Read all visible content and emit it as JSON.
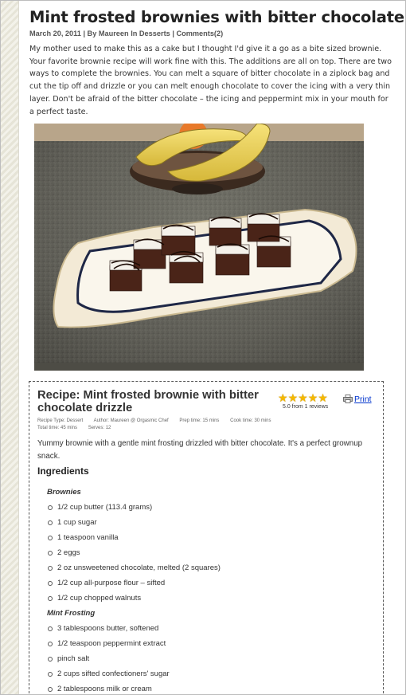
{
  "post": {
    "title": "Mint frosted brownies with bitter chocolate drizzle",
    "date": "March 20, 2011",
    "by": "| By Maureen In",
    "category": "Desserts",
    "sep": "|",
    "comments": "Comments(2)",
    "intro": "My mother used to make this as a cake but I thought I'd give it a go as a bite sized brownie.  Your favorite brownie recipe will work fine with this.  The additions are all on top.   There are two ways to complete the brownies.  You can melt a square of bitter chocolate in a ziplock bag and cut the tip off and drizzle or you can melt enough chocolate to cover the icing with a very thin layer.  Don't be afraid of the bitter chocolate – the icing and peppermint mix in your mouth for a perfect taste."
  },
  "recipe": {
    "title": "Recipe: Mint frosted brownie with bitter chocolate drizzle",
    "rating_text": "5.0 from 1 reviews",
    "rating_value": 5,
    "print_label": "Print",
    "meta": {
      "type": "Recipe Type: Dessert",
      "author": "Author: Maureen @ Orgasmic Chef",
      "prep": "Prep time: 15 mins",
      "cook": "Cook time: 30 mins",
      "total": "Total time: 45 mins",
      "serves": "Serves: 12"
    },
    "summary": "Yummy brownie with a gentle mint frosting drizzled with bitter chocolate. It's a perfect grownup snack.",
    "ingredients_heading": "Ingredients",
    "groups": [
      {
        "title": "Brownies",
        "items": [
          "1/2 cup butter (113.4 grams)",
          "1 cup sugar",
          "1 teaspoon vanilla",
          "2 eggs",
          "2 oz unsweetened chocolate, melted (2 squares)",
          "1/2 cup all-purpose flour – sifted",
          "1/2 cup chopped walnuts"
        ]
      },
      {
        "title": "Mint Frosting",
        "items": [
          "3 tablespoons butter, softened",
          "1/2 teaspoon peppermint extract",
          "pinch salt",
          "2 cups sifted confectioners' sugar",
          "2 tablespoons milk or cream"
        ]
      }
    ]
  },
  "colors": {
    "link": "#0033cc",
    "star": "#f5b800",
    "text": "#333333"
  }
}
